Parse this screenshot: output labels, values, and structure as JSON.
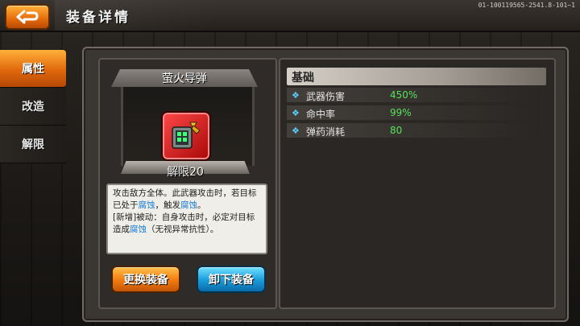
{
  "header": {
    "back_icon": "back-arrow-icon",
    "title": "装备详情",
    "build_id": "01-100119565-2541.8-101~1"
  },
  "sidebar": {
    "items": [
      {
        "label": "属性",
        "active": true
      },
      {
        "label": "改造",
        "active": false
      },
      {
        "label": "解限",
        "active": false
      }
    ]
  },
  "item": {
    "name": "萤火导弹",
    "limit_break": "解限20",
    "icon": "missile-pod-icon",
    "rarity_color": "#e02020",
    "description": {
      "p1_a": "攻击敌方全体。此武器攻击时，若目标已处于",
      "p1_kw": "腐蚀",
      "p1_b": "，触发",
      "p1_kw2": "腐蚀",
      "p1_c": "。",
      "p2_a": "[新增]被动：自身攻击时，必定对目标造成",
      "p2_kw": "腐蚀",
      "p2_b": "（无视异常抗性）。"
    }
  },
  "buttons": {
    "replace_label": "更换装备",
    "unequip_label": "卸下装备"
  },
  "stats": {
    "header": "基础",
    "rows": [
      {
        "name": "武器伤害",
        "value": "450%"
      },
      {
        "name": "命中率",
        "value": "99%"
      },
      {
        "name": "弹药消耗",
        "value": "80"
      }
    ]
  },
  "colors": {
    "accent_orange": "#f07a10",
    "accent_blue": "#1a9ad8",
    "stat_value_green": "#58e05a",
    "keyword_blue": "#1a7ed6"
  }
}
